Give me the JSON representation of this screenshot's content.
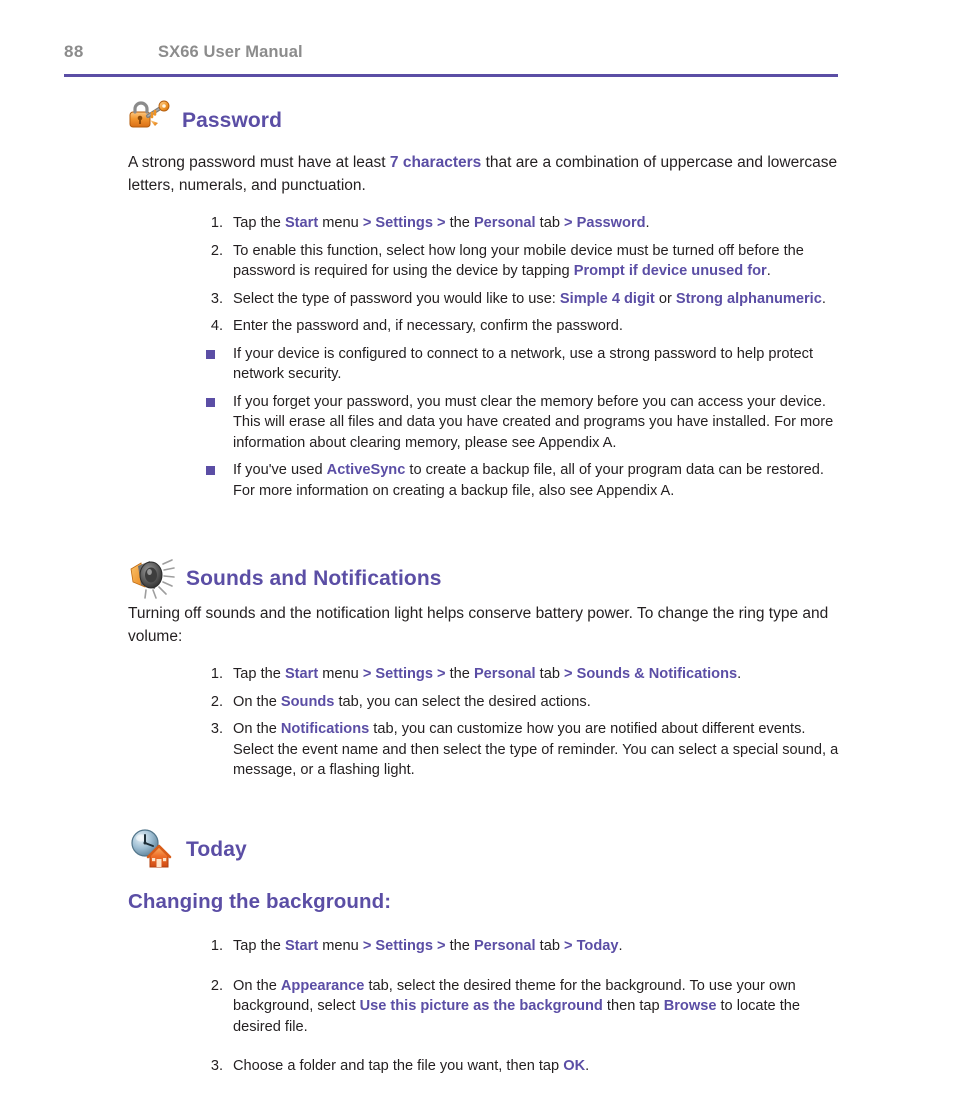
{
  "header": {
    "page_number": "88",
    "title": "SX66 User Manual",
    "rule_color": "#5b4ea5",
    "text_color": "#8c8c8c"
  },
  "theme": {
    "accent": "#5b4ea5",
    "body_text": "#231f20",
    "icon_orange": "#f08a24",
    "icon_gray": "#5a5a5a",
    "icon_blue": "#8fb3cc"
  },
  "sections": [
    {
      "id": "password",
      "icon_name": "padlock-key-icon",
      "title": "Password",
      "intro": {
        "part1": "A strong password must have at least ",
        "hl1": "7 characters",
        "part2": " that are a combination of uppercase and lowercase letters, numerals, and punctuation."
      },
      "steps": [
        {
          "num": "1.",
          "p1": "Tap the ",
          "h1": "Start",
          "p2": " menu ",
          "h2": "> Settings >",
          "p3": " the ",
          "h3": "Personal",
          "p4": " tab ",
          "h4": "> Password",
          "p5": "."
        },
        {
          "num": "2.",
          "p1": "To enable this function, select how long your mobile device must be turned off before the password is required for using the device by tapping ",
          "h1": "Prompt if device unused for",
          "p2": "."
        },
        {
          "num": "3.",
          "p1": "Select the type of password you would like to use: ",
          "h1": "Simple 4 digit",
          "p2": " or ",
          "h2": "Strong alphanumeric",
          "p3": "."
        },
        {
          "num": "4.",
          "p1": "Enter the password and, if necessary, confirm the password."
        }
      ],
      "bullets": [
        {
          "p1": "If your device is configured to connect to a network, use a strong password to help protect network security."
        },
        {
          "p1": "If you forget your password, you must clear the memory before you can access your device. This will erase all files and data you have created and programs you have installed. For more information about clearing memory, please see Appendix A."
        },
        {
          "p1": "If you've used ",
          "h1": "ActiveSync",
          "p2": " to create a backup file, all of your program data can be restored. For more information on creating a backup file, also see Appendix A."
        }
      ]
    },
    {
      "id": "sounds",
      "icon_name": "speaker-sound-icon",
      "title": "Sounds and Notifications",
      "intro": {
        "part1": "Turning off sounds and the notification light helps conserve battery power. To change the ring type and volume:"
      },
      "steps": [
        {
          "num": "1.",
          "p1": "Tap the ",
          "h1": "Start",
          "p2": " menu ",
          "h2": "> Settings >",
          "p3": " the ",
          "h3": "Personal",
          "p4": " tab ",
          "h4": "> Sounds & Notifications",
          "p5": "."
        },
        {
          "num": "2.",
          "p1": "On the ",
          "h1": "Sounds",
          "p2": " tab, you can select the desired actions."
        },
        {
          "num": "3.",
          "p1": "On the ",
          "h1": "Notifications",
          "p2": " tab, you can customize how you are notified about different events. Select the event name and then select the type of reminder. You can select a special sound, a message, or a flashing light."
        }
      ]
    },
    {
      "id": "today",
      "icon_name": "clock-house-icon",
      "title": "Today",
      "subheading": "Changing the background:",
      "steps": [
        {
          "num": "1.",
          "p1": "Tap the ",
          "h1": "Start",
          "p2": " menu ",
          "h2": "> Settings >",
          "p3": " the ",
          "h3": "Personal",
          "p4": " tab ",
          "h4": "> Today",
          "p5": "."
        },
        {
          "num": "2.",
          "p1": "On the ",
          "h1": "Appearance",
          "p2": " tab, select the desired theme for the background. To use your own background, select ",
          "h2": "Use this picture as the background",
          "p3": " then tap ",
          "h3": "Browse",
          "p4": " to locate the desired file."
        },
        {
          "num": "3.",
          "p1": "Choose a folder and tap the file you want, then tap ",
          "h1": "OK",
          "p2": "."
        }
      ]
    }
  ]
}
